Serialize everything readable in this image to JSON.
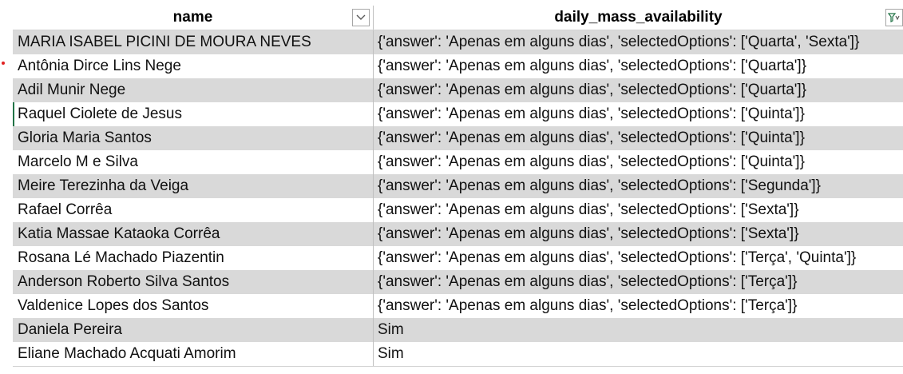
{
  "columns": {
    "name_header": "name",
    "availability_header": "daily_mass_availability"
  },
  "rows": [
    {
      "name": "MARIA ISABEL PICINI DE MOURA NEVES",
      "availability": "{'answer': 'Apenas em alguns dias', 'selectedOptions': ['Quarta', 'Sexta']}"
    },
    {
      "name": "Antônia Dirce Lins Nege",
      "availability": "{'answer': 'Apenas em alguns dias', 'selectedOptions': ['Quarta']}"
    },
    {
      "name": "Adil Munir Nege",
      "availability": "{'answer': 'Apenas em alguns dias', 'selectedOptions': ['Quarta']}"
    },
    {
      "name": "Raquel Ciolete de Jesus",
      "availability": "{'answer': 'Apenas em alguns dias', 'selectedOptions': ['Quinta']}"
    },
    {
      "name": "Gloria Maria Santos",
      "availability": "{'answer': 'Apenas em alguns dias', 'selectedOptions': ['Quinta']}"
    },
    {
      "name": "Marcelo M e Silva",
      "availability": "{'answer': 'Apenas em alguns dias', 'selectedOptions': ['Quinta']}"
    },
    {
      "name": "Meire Terezinha da Veiga",
      "availability": "{'answer': 'Apenas em alguns dias', 'selectedOptions': ['Segunda']}"
    },
    {
      "name": "Rafael Corrêa",
      "availability": "{'answer': 'Apenas em alguns dias', 'selectedOptions': ['Sexta']}"
    },
    {
      "name": "Katia Massae Kataoka Corrêa",
      "availability": "{'answer': 'Apenas em alguns dias', 'selectedOptions': ['Sexta']}"
    },
    {
      "name": "Rosana Lé Machado Piazentin",
      "availability": "{'answer': 'Apenas em alguns dias', 'selectedOptions': ['Terça', 'Quinta']}"
    },
    {
      "name": "Anderson Roberto Silva Santos",
      "availability": "{'answer': 'Apenas em alguns dias', 'selectedOptions': ['Terça']}"
    },
    {
      "name": "Valdenice Lopes dos Santos",
      "availability": "{'answer': 'Apenas em alguns dias', 'selectedOptions': ['Terça']}"
    },
    {
      "name": "Daniela Pereira",
      "availability": "Sim"
    },
    {
      "name": "Eliane Machado Acquati Amorim",
      "availability": "Sim"
    }
  ],
  "icons": {
    "name_filter": "dropdown-arrow-icon",
    "availability_filter": "filter-applied-icon"
  },
  "colors": {
    "band": "#d9d9d9",
    "gridline": "#bfbfbf",
    "filter_active": "#217346",
    "marker": "#e02020"
  }
}
